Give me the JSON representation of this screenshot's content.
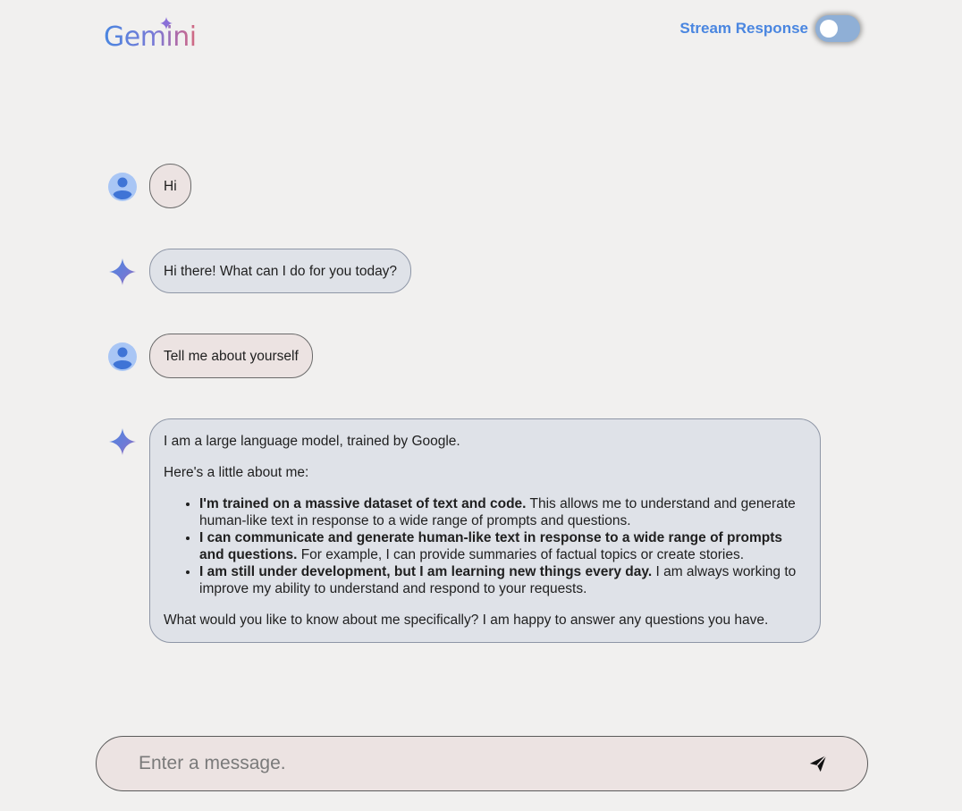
{
  "header": {
    "logo_text": "Gemini",
    "stream_label": "Stream Response",
    "stream_enabled": false
  },
  "messages": [
    {
      "role": "user",
      "text": "Hi"
    },
    {
      "role": "model",
      "text": "Hi there! What can I do for you today?"
    },
    {
      "role": "user",
      "text": "Tell me about yourself"
    },
    {
      "role": "model",
      "intro": "I am a large language model, trained by Google.",
      "lead": "Here's a little about me:",
      "bullets": [
        {
          "bold": "I'm trained on a massive dataset of text and code.",
          "rest": "This allows me to understand and generate human-like text in response to a wide range of prompts and questions."
        },
        {
          "bold": "I can communicate and generate human-like text in response to a wide range of prompts and questions.",
          "rest": "For example, I can provide summaries of factual topics or create stories."
        },
        {
          "bold": "I am still under development, but I am learning new things every day.",
          "rest": "I am always working to improve my ability to understand and respond to your requests."
        }
      ],
      "closing": "What would you like to know about me specifically? I am happy to answer any questions you have."
    }
  ],
  "composer": {
    "placeholder": "Enter a message."
  },
  "icons": {
    "user_avatar": "user-avatar-icon",
    "model_avatar": "gemini-sparkle-icon",
    "send": "send-icon"
  },
  "colors": {
    "brand_blue": "#4a86e0",
    "user_bubble": "#ece3e2",
    "model_bubble": "#dfe2e8",
    "background": "#f1f0ef"
  }
}
